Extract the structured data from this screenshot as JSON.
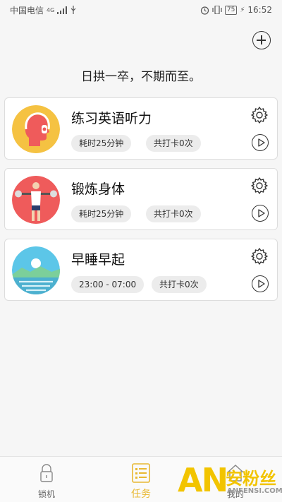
{
  "status": {
    "carrier": "中国电信",
    "network": "4G",
    "battery": "75",
    "time": "16:52"
  },
  "header": {
    "add_icon": "plus-circle-icon",
    "motto": "日拱一卒，不期而至。"
  },
  "tasks": [
    {
      "title": "练习英语听力",
      "tag1": "耗时25分钟",
      "tag2": "共打卡0次",
      "avatar_color": "#f5c242"
    },
    {
      "title": "锻炼身体",
      "tag1": "耗时25分钟",
      "tag2": "共打卡0次",
      "avatar_color": "#ef5b5b"
    },
    {
      "title": "早睡早起",
      "tag1": "23:00 - 07:00",
      "tag2": "共打卡0次",
      "avatar_color": "#5cc6e8"
    }
  ],
  "nav": {
    "items": [
      {
        "label": "锁机",
        "icon": "lock-icon"
      },
      {
        "label": "任务",
        "icon": "task-list-icon"
      },
      {
        "label": "我的",
        "icon": "home-icon"
      }
    ],
    "active_color": "#e8b832"
  },
  "watermark": {
    "logo": "AN",
    "cn": "安粉丝",
    "en": "ANFENSI.COM"
  }
}
